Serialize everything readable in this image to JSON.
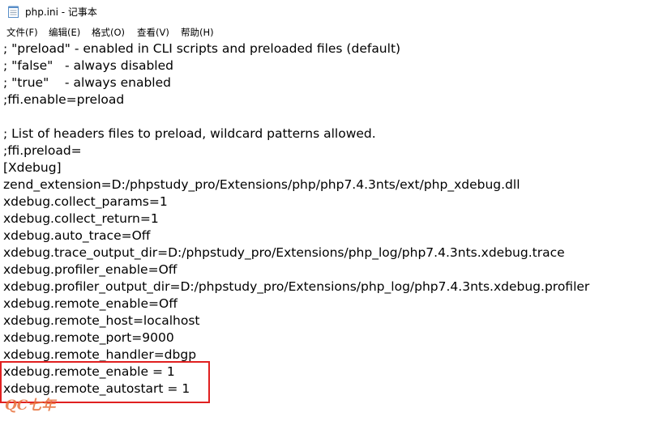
{
  "window": {
    "title": "php.ini - 记事本",
    "icon": "notepad-icon"
  },
  "menu": {
    "items": [
      {
        "label": "文件(F)"
      },
      {
        "label": "编辑(E)"
      },
      {
        "label": "格式(O)"
      },
      {
        "label": "查看(V)"
      },
      {
        "label": "帮助(H)"
      }
    ]
  },
  "editor": {
    "lines": [
      "; \"preload\" - enabled in CLI scripts and preloaded files (default)",
      "; \"false\"   - always disabled",
      "; \"true\"    - always enabled",
      ";ffi.enable=preload",
      "",
      "; List of headers files to preload, wildcard patterns allowed.",
      ";ffi.preload=",
      "[Xdebug]",
      "zend_extension=D:/phpstudy_pro/Extensions/php/php7.4.3nts/ext/php_xdebug.dll",
      "xdebug.collect_params=1",
      "xdebug.collect_return=1",
      "xdebug.auto_trace=Off",
      "xdebug.trace_output_dir=D:/phpstudy_pro/Extensions/php_log/php7.4.3nts.xdebug.trace",
      "xdebug.profiler_enable=Off",
      "xdebug.profiler_output_dir=D:/phpstudy_pro/Extensions/php_log/php7.4.3nts.xdebug.profiler",
      "xdebug.remote_enable=Off",
      "xdebug.remote_host=localhost",
      "xdebug.remote_port=9000",
      "xdebug.remote_handler=dbgp",
      "xdebug.remote_enable = 1",
      "xdebug.remote_autostart = 1"
    ]
  },
  "annotation": {
    "highlight_color": "#e02020"
  },
  "watermark": {
    "text": "QC七年"
  }
}
